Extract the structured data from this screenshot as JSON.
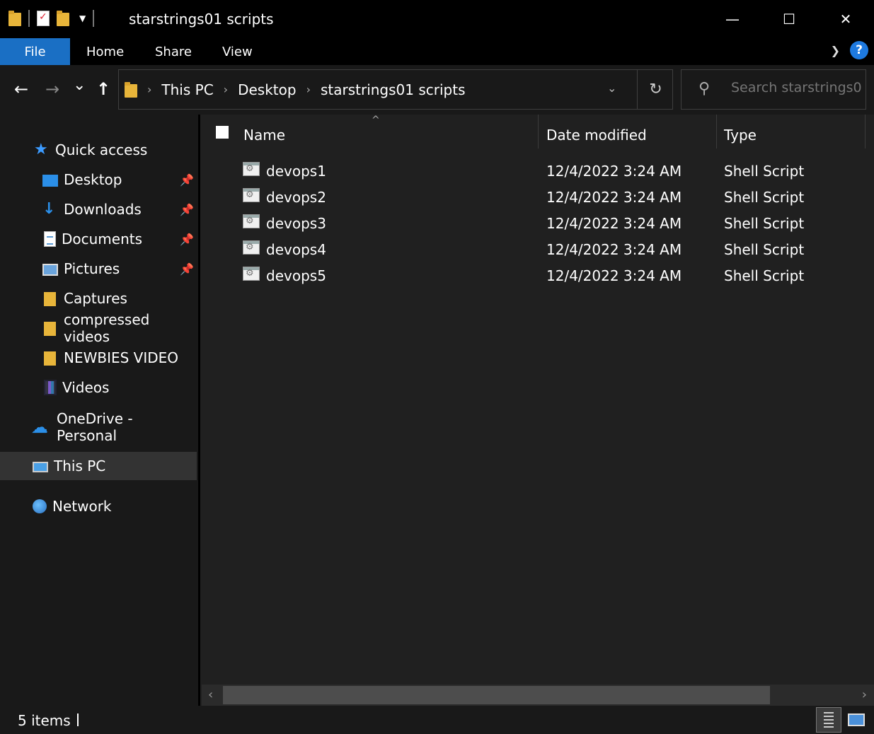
{
  "window": {
    "title": "starstrings01 scripts",
    "minimize": "—",
    "maximize": "☐",
    "close": "✕"
  },
  "ribbon": {
    "tabs": [
      "File",
      "Home",
      "Share",
      "View"
    ],
    "help": "?"
  },
  "navigation": {
    "back": "←",
    "forward": "→",
    "recent": "⌄",
    "up": "↑",
    "breadcrumb": [
      "This PC",
      "Desktop",
      "starstrings01 scripts"
    ],
    "refresh": "↻",
    "search_placeholder": "Search starstrings0..."
  },
  "sidebar": {
    "quick_access": "Quick access",
    "items": [
      {
        "label": "Desktop",
        "icon": "desktop-icon",
        "pinned": true
      },
      {
        "label": "Downloads",
        "icon": "download-icon",
        "pinned": true
      },
      {
        "label": "Documents",
        "icon": "documents-icon",
        "pinned": true
      },
      {
        "label": "Pictures",
        "icon": "pictures-icon",
        "pinned": true
      },
      {
        "label": "Captures",
        "icon": "folder-icon",
        "pinned": false
      },
      {
        "label": "compressed videos",
        "icon": "folder-icon",
        "pinned": false
      },
      {
        "label": "NEWBIES VIDEO",
        "icon": "folder-icon",
        "pinned": false
      },
      {
        "label": "Videos",
        "icon": "videos-icon",
        "pinned": false
      }
    ],
    "onedrive": "OneDrive - Personal",
    "this_pc": "This PC",
    "network": "Network"
  },
  "file_list": {
    "columns": [
      "Name",
      "Date modified",
      "Type"
    ],
    "rows": [
      {
        "name": "devops1",
        "date": "12/4/2022 3:24 AM",
        "type": "Shell Script"
      },
      {
        "name": "devops2",
        "date": "12/4/2022 3:24 AM",
        "type": "Shell Script"
      },
      {
        "name": "devops3",
        "date": "12/4/2022 3:24 AM",
        "type": "Shell Script"
      },
      {
        "name": "devops4",
        "date": "12/4/2022 3:24 AM",
        "type": "Shell Script"
      },
      {
        "name": "devops5",
        "date": "12/4/2022 3:24 AM",
        "type": "Shell Script"
      }
    ]
  },
  "status": {
    "item_count": "5 items"
  },
  "colors": {
    "accent": "#1a6fc4",
    "background": "#202020",
    "sidebar": "#191919",
    "selection": "#333333"
  }
}
